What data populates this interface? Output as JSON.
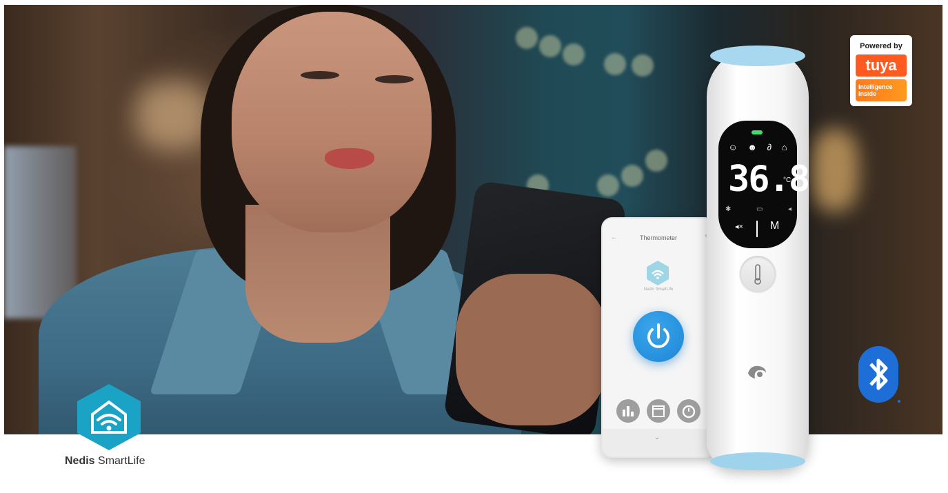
{
  "app": {
    "header_title": "Thermometer",
    "brand_caption": "Nedis SmartLife"
  },
  "thermometer": {
    "temperature": "36.8",
    "unit": "°C",
    "mode_label": "M"
  },
  "tuya_badge": {
    "powered_by": "Powered by",
    "logo_text": "tuya",
    "tagline_line1": "Intelligence",
    "tagline_line2": "Inside"
  },
  "smartlife": {
    "brand_name_bold": "Nedis",
    "brand_name_rest": "SmartLife"
  },
  "colors": {
    "app_accent": "#1d86d6",
    "smartlife_teal": "#1aa3c4",
    "tuya_orange": "#ff5a1f",
    "bluetooth_blue": "#1e6ed8",
    "led_green": "#3be06a"
  },
  "icons": [
    "wifi-house-icon",
    "power-icon",
    "chart-icon",
    "calendar-icon",
    "timer-icon",
    "bluetooth-icon",
    "thermometer-icon",
    "nedis-logo-icon"
  ]
}
